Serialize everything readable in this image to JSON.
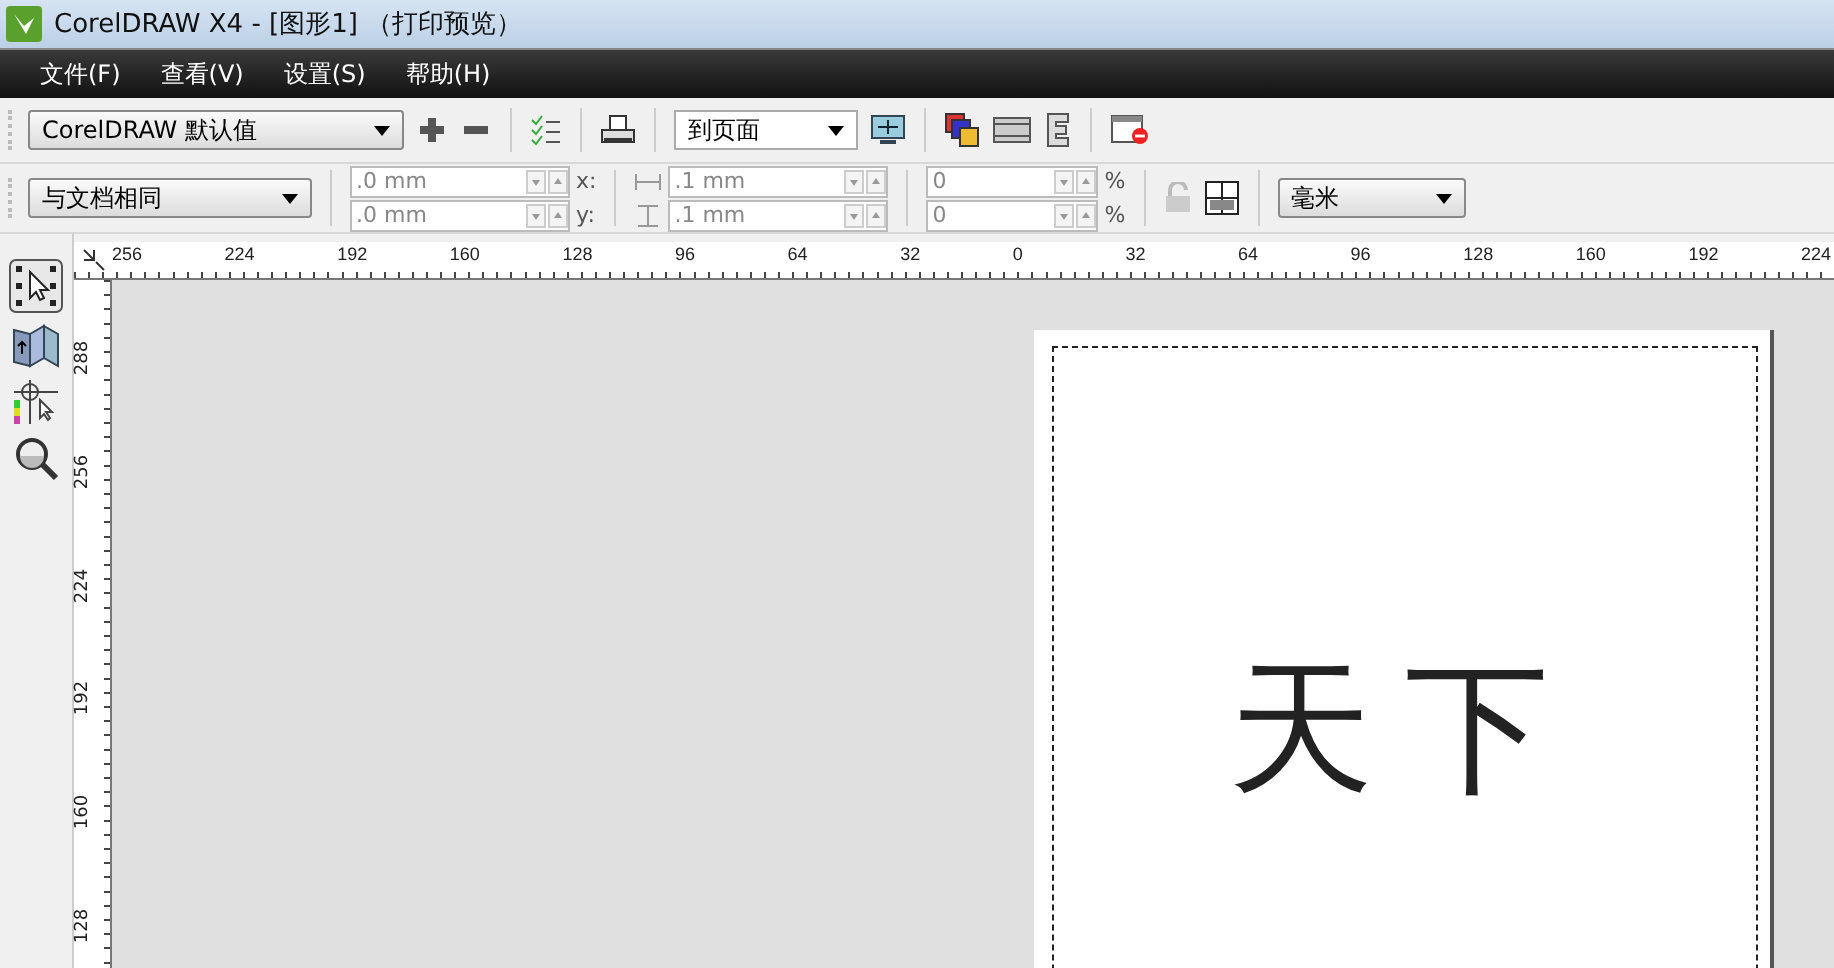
{
  "window": {
    "title": "CorelDRAW X4 - [图形1] （打印预览）"
  },
  "menu": [
    "文件(F)",
    "查看(V)",
    "设置(S)",
    "帮助(H)"
  ],
  "toolbar": {
    "preset": "CorelDRAW 默认值",
    "zoom": "到页面"
  },
  "property_bar": {
    "layout": "与文档相同",
    "position_fields": [
      {
        "value": ".0 mm",
        "axis": "x:",
        "disabled": true
      },
      {
        "value": ".0 mm",
        "axis": "y:",
        "disabled": true
      }
    ],
    "gap_fields": [
      {
        "value": ".1 mm",
        "disabled": true
      },
      {
        "value": ".1 mm",
        "disabled": true
      }
    ],
    "percent_fields": [
      {
        "value": "0",
        "unit": "%",
        "disabled": true
      },
      {
        "value": "0",
        "unit": "%",
        "disabled": true
      }
    ],
    "units": "毫米"
  },
  "ruler_h": [
    "256",
    "224",
    "192",
    "160",
    "128",
    "96",
    "64",
    "32",
    "0",
    "32",
    "64",
    "96",
    "128",
    "160",
    "192",
    "224"
  ],
  "ruler_v": [
    "288",
    "256",
    "224",
    "192",
    "160",
    "128"
  ],
  "page": {
    "text": "天下"
  }
}
